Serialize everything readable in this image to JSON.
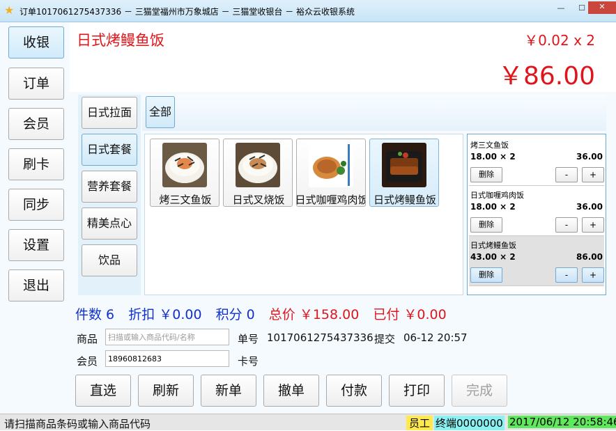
{
  "window": {
    "title": "订单1017061275437336 － 三猫堂福州市万象城店 － 三猫堂收银台 － 裕众云收银系统",
    "minimize": "—",
    "maximize": "☐",
    "close": "✕"
  },
  "sidebar": {
    "items": [
      {
        "label": "收银"
      },
      {
        "label": "订单"
      },
      {
        "label": "会员"
      },
      {
        "label": "刷卡"
      },
      {
        "label": "同步"
      },
      {
        "label": "设置"
      },
      {
        "label": "退出"
      }
    ]
  },
  "current": {
    "name": "日式烤鳗鱼饭",
    "price_line": "￥0.02 x 2",
    "total": "￥86.00"
  },
  "categories": [
    {
      "label": "日式拉面"
    },
    {
      "label": "日式套餐"
    },
    {
      "label": "营养套餐"
    },
    {
      "label": "精美点心"
    },
    {
      "label": "饮品"
    }
  ],
  "subcategory": {
    "label": "全部"
  },
  "products": [
    {
      "name": "烤三文鱼饭",
      "icon": "salmon-rice-bowl-icon"
    },
    {
      "name": "日式叉烧饭",
      "icon": "chashu-rice-bowl-icon"
    },
    {
      "name": "日式咖喱鸡肉饭",
      "icon": "curry-chicken-rice-icon"
    },
    {
      "name": "日式烤鳗鱼饭",
      "icon": "eel-rice-icon"
    }
  ],
  "cart": {
    "delete_label": "删除",
    "minus_label": "-",
    "plus_label": "+",
    "items": [
      {
        "name": "烤三文鱼饭",
        "qty": "18.00 × 2",
        "sum": "36.00"
      },
      {
        "name": "日式咖喱鸡肉饭",
        "qty": "18.00 × 2",
        "sum": "36.00"
      },
      {
        "name": "日式烤鳗鱼饭",
        "qty": "43.00 × 2",
        "sum": "86.00"
      }
    ]
  },
  "summary": {
    "count": "件数 6",
    "discount": "折扣 ￥0.00",
    "points": "积分 0",
    "total": "总价 ￥158.00",
    "paid": "已付 ￥0.00"
  },
  "form": {
    "product_label": "商品",
    "product_placeholder": "扫描或输入商品代码/名称",
    "order_no_label": "单号",
    "order_no": "1017061275437336",
    "submit_label": "提交",
    "submit_time": "06-12 20:57",
    "member_label": "会员",
    "member_value": "18960812683",
    "card_label": "卡号"
  },
  "actions": [
    {
      "label": "直选"
    },
    {
      "label": "刷新"
    },
    {
      "label": "新单"
    },
    {
      "label": "撤单"
    },
    {
      "label": "付款"
    },
    {
      "label": "打印"
    },
    {
      "label": "完成"
    }
  ],
  "status": {
    "message": "请扫描商品条码或输入商品代码",
    "staff": "员工",
    "terminal": "终端0000000",
    "datetime": "2017/06/12 20:58:46"
  },
  "colors": {
    "accent_red": "#e0151b",
    "accent_blue": "#1030d0",
    "staff_bg": "#ffe94f",
    "terminal_bg": "#8af2f2",
    "time_bg": "#5fe85b"
  }
}
